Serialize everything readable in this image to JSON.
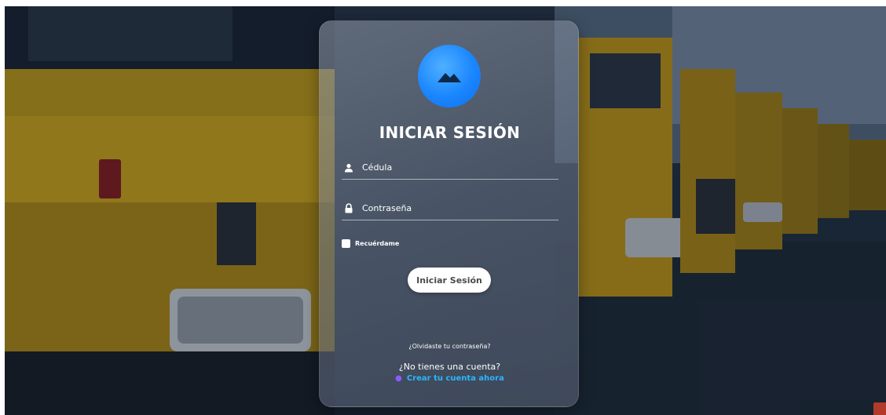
{
  "login": {
    "title": "INICIAR SESIÓN",
    "username_placeholder": "Cédula",
    "password_placeholder": "Contraseña",
    "remember_label": "Recuérdame",
    "submit_label": "Iniciar Sesión",
    "forgot_link": "¿Olvidaste tu contraseña?",
    "no_account_text": "¿No tienes una cuenta?",
    "create_link": "Crear tu cuenta ahora"
  },
  "icons": {
    "logo": "mountain-icon",
    "username": "user-icon",
    "password": "lock-icon"
  },
  "colors": {
    "logo_blue": "#1a86ff",
    "link_blue": "#28b7ff",
    "bus_yellow": "#f2b313"
  }
}
